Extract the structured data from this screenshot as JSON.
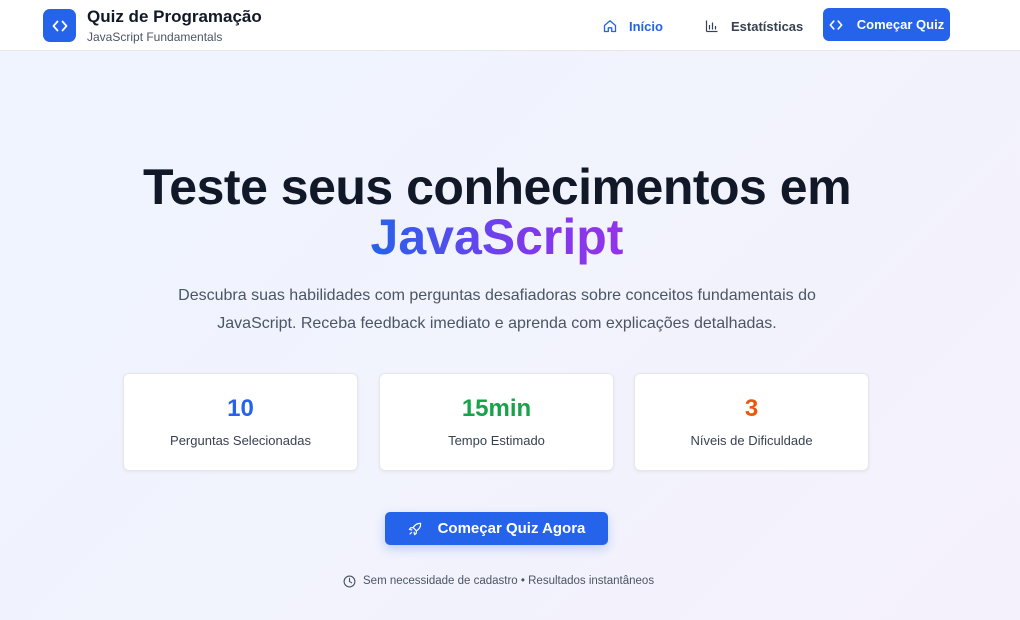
{
  "header": {
    "title": "Quiz de Programação",
    "subtitle": "JavaScript Fundamentals",
    "logo_icon": "code-icon",
    "nav": [
      {
        "label": "Início",
        "icon": "home-icon",
        "active": true
      },
      {
        "label": "Estatísticas",
        "icon": "bar-chart-icon",
        "active": false
      }
    ],
    "cta_label": "Começar Quiz",
    "cta_icon": "code-icon"
  },
  "hero": {
    "title_line1": "Teste seus conhecimentos em",
    "title_line2": "JavaScript",
    "description": "Descubra suas habilidades com perguntas desafiadoras sobre conceitos fundamentais do JavaScript. Receba feedback imediato e aprenda com explicações detalhadas."
  },
  "stats": [
    {
      "value": "10",
      "label": "Perguntas Selecionadas",
      "color": "#2563eb"
    },
    {
      "value": "15min",
      "label": "Tempo Estimado",
      "color": "#16a34a"
    },
    {
      "value": "3",
      "label": "Níveis de Dificuldade",
      "color": "#ea580c"
    }
  ],
  "cta": {
    "label": "Começar Quiz Agora",
    "icon": "rocket-icon"
  },
  "footnote": {
    "icon": "clock-icon",
    "text": "Sem necessidade de cadastro • Resultados instantâneos"
  },
  "colors": {
    "accent": "#2563eb",
    "gradient_start": "#2563eb",
    "gradient_end": "#9333ea"
  }
}
